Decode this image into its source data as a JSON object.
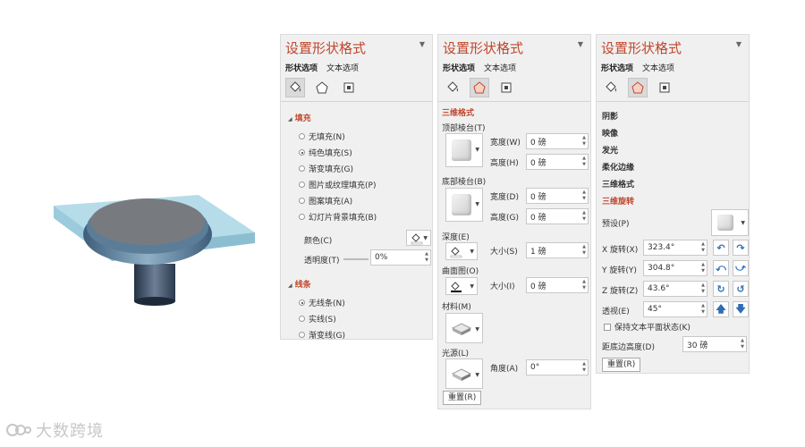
{
  "watermark": {
    "text": "大数跨境"
  },
  "panel1": {
    "title": "设置形状格式",
    "tabs": [
      "形状选项",
      "文本选项"
    ],
    "fill": {
      "header": "填充",
      "options": [
        "无填充(N)",
        "纯色填充(S)",
        "渐变填充(G)",
        "图片或纹理填充(P)",
        "图案填充(A)",
        "幻灯片背景填充(B)"
      ],
      "selected_index": 1,
      "color_label": "颜色(C)",
      "transparency_label": "透明度(T)",
      "transparency_value": "0%"
    },
    "line": {
      "header": "线条",
      "options": [
        "无线条(N)",
        "实线(S)",
        "渐变线(G)"
      ],
      "selected_index": 0
    }
  },
  "panel2": {
    "title": "设置形状格式",
    "tabs": [
      "形状选项",
      "文本选项"
    ],
    "section": "三维格式",
    "top_bevel": {
      "label": "顶部棱台(T)",
      "width_label": "宽度(W)",
      "width_value": "0 磅",
      "height_label": "高度(H)",
      "height_value": "0 磅"
    },
    "bottom_bevel": {
      "label": "底部棱台(B)",
      "width_label": "宽度(D)",
      "width_value": "0 磅",
      "height_label": "高度(G)",
      "height_value": "0 磅"
    },
    "depth": {
      "label": "深度(E)",
      "size_label": "大小(S)",
      "size_value": "1 磅"
    },
    "contour": {
      "label": "曲面图(O)",
      "size_label": "大小(I)",
      "size_value": "0 磅"
    },
    "material_label": "材料(M)",
    "lighting": {
      "label": "光源(L)",
      "angle_label": "角度(A)",
      "angle_value": "0°"
    },
    "reset_label": "重置(R)"
  },
  "panel3": {
    "title": "设置形状格式",
    "tabs": [
      "形状选项",
      "文本选项"
    ],
    "sections": [
      "阴影",
      "映像",
      "发光",
      "柔化边缘",
      "三维格式",
      "三维旋转"
    ],
    "active_section": "三维旋转",
    "preset_label": "预设(P)",
    "x_rotation": {
      "label": "X 旋转(X)",
      "value": "323.4°"
    },
    "y_rotation": {
      "label": "Y 旋转(Y)",
      "value": "304.8°"
    },
    "z_rotation": {
      "label": "Z 旋转(Z)",
      "value": "43.6°"
    },
    "perspective": {
      "label": "透视(E)",
      "value": "45°"
    },
    "keep_text_flat_label": "保持文本平面状态(K)",
    "distance_label": "距底边高度(D)",
    "distance_value": "30 磅",
    "reset_label": "重置(R)"
  },
  "colors": {
    "accent": "#c0462c",
    "panel_bg": "#f0f0f0",
    "rotate_icon": "#2e6db5"
  }
}
